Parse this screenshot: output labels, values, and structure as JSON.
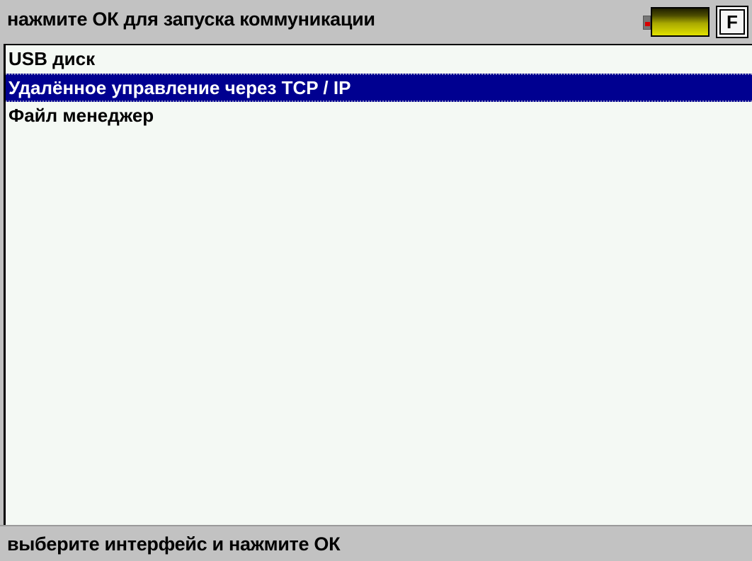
{
  "header": {
    "title": "нажмите ОК для запуска коммуникации",
    "battery_icon": "battery-icon",
    "function_key_label": "F"
  },
  "menu": {
    "items": [
      {
        "label": "USB диск",
        "selected": false
      },
      {
        "label": "Удалённое управление через TCP / IP",
        "selected": true
      },
      {
        "label": "Файл менеджер",
        "selected": false
      }
    ]
  },
  "footer": {
    "hint": "выберите интерфейс и нажмите ОК"
  },
  "colors": {
    "selection": "#000090",
    "panel_background": "#f4f9f4",
    "bar_background": "#c2c2c2",
    "battery_low": "#d90000"
  }
}
